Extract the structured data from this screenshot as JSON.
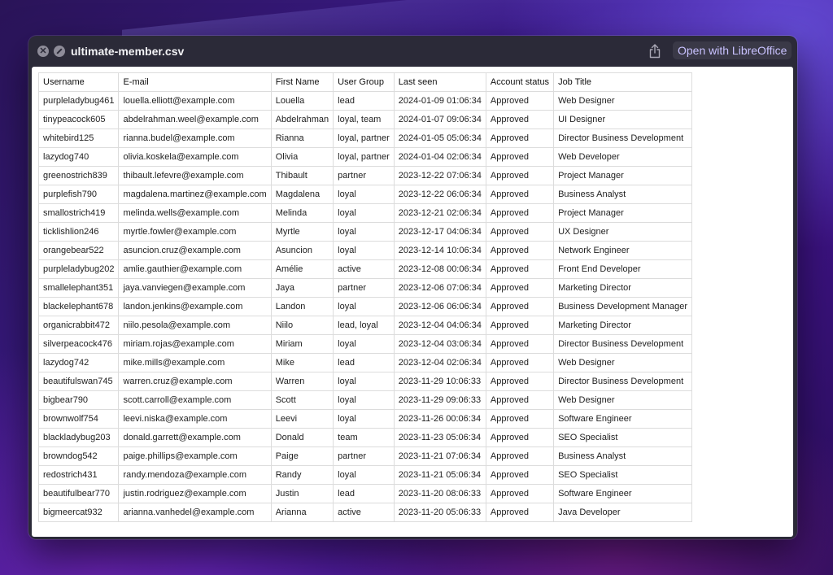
{
  "window": {
    "title": "ultimate-member.csv",
    "open_with_label": "Open with LibreOffice",
    "close_icon_glyph": "✕"
  },
  "icons": [
    "close-icon",
    "block-icon",
    "share-icon"
  ],
  "table": {
    "columns": [
      "Username",
      "E-mail",
      "First Name",
      "User Group",
      "Last seen",
      "Account status",
      "Job Title"
    ],
    "rows": [
      [
        "purpleladybug461",
        "louella.elliott@example.com",
        "Louella",
        "lead",
        "2024-01-09 01:06:34",
        "Approved",
        "Web Designer"
      ],
      [
        "tinypeacock605",
        "abdelrahman.weel@example.com",
        "Abdelrahman",
        "loyal, team",
        "2024-01-07 09:06:34",
        "Approved",
        "UI Designer"
      ],
      [
        "whitebird125",
        "rianna.budel@example.com",
        "Rianna",
        "loyal, partner",
        "2024-01-05 05:06:34",
        "Approved",
        "Director Business Development"
      ],
      [
        "lazydog740",
        "olivia.koskela@example.com",
        "Olivia",
        "loyal, partner",
        "2024-01-04 02:06:34",
        "Approved",
        "Web Developer"
      ],
      [
        "greenostrich839",
        "thibault.lefevre@example.com",
        "Thibault",
        "partner",
        "2023-12-22 07:06:34",
        "Approved",
        "Project Manager"
      ],
      [
        "purplefish790",
        "magdalena.martinez@example.com",
        "Magdalena",
        "loyal",
        "2023-12-22 06:06:34",
        "Approved",
        "Business Analyst"
      ],
      [
        "smallostrich419",
        "melinda.wells@example.com",
        "Melinda",
        "loyal",
        "2023-12-21 02:06:34",
        "Approved",
        "Project Manager"
      ],
      [
        "ticklishlion246",
        "myrtle.fowler@example.com",
        "Myrtle",
        "loyal",
        "2023-12-17 04:06:34",
        "Approved",
        "UX Designer"
      ],
      [
        "orangebear522",
        "asuncion.cruz@example.com",
        "Asuncion",
        "loyal",
        "2023-12-14 10:06:34",
        "Approved",
        "Network Engineer"
      ],
      [
        "purpleladybug202",
        "amlie.gauthier@example.com",
        "Amélie",
        "active",
        "2023-12-08 00:06:34",
        "Approved",
        "Front End Developer"
      ],
      [
        "smallelephant351",
        "jaya.vanviegen@example.com",
        "Jaya",
        "partner",
        "2023-12-06 07:06:34",
        "Approved",
        "Marketing Director"
      ],
      [
        "blackelephant678",
        "landon.jenkins@example.com",
        "Landon",
        "loyal",
        "2023-12-06 06:06:34",
        "Approved",
        "Business Development Manager"
      ],
      [
        "organicrabbit472",
        "niilo.pesola@example.com",
        "Niilo",
        "lead, loyal",
        "2023-12-04 04:06:34",
        "Approved",
        "Marketing Director"
      ],
      [
        "silverpeacock476",
        "miriam.rojas@example.com",
        "Miriam",
        "loyal",
        "2023-12-04 03:06:34",
        "Approved",
        "Director Business Development"
      ],
      [
        "lazydog742",
        "mike.mills@example.com",
        "Mike",
        "lead",
        "2023-12-04 02:06:34",
        "Approved",
        "Web Designer"
      ],
      [
        "beautifulswan745",
        "warren.cruz@example.com",
        "Warren",
        "loyal",
        "2023-11-29 10:06:33",
        "Approved",
        "Director Business Development"
      ],
      [
        "bigbear790",
        "scott.carroll@example.com",
        "Scott",
        "loyal",
        "2023-11-29 09:06:33",
        "Approved",
        "Web Designer"
      ],
      [
        "brownwolf754",
        "leevi.niska@example.com",
        "Leevi",
        "loyal",
        "2023-11-26 00:06:34",
        "Approved",
        "Software Engineer"
      ],
      [
        "blackladybug203",
        "donald.garrett@example.com",
        "Donald",
        "team",
        "2023-11-23 05:06:34",
        "Approved",
        "SEO Specialist"
      ],
      [
        "browndog542",
        "paige.phillips@example.com",
        "Paige",
        "partner",
        "2023-11-21 07:06:34",
        "Approved",
        "Business Analyst"
      ],
      [
        "redostrich431",
        "randy.mendoza@example.com",
        "Randy",
        "loyal",
        "2023-11-21 05:06:34",
        "Approved",
        "SEO Specialist"
      ],
      [
        "beautifulbear770",
        "justin.rodriguez@example.com",
        "Justin",
        "lead",
        "2023-11-20 08:06:33",
        "Approved",
        "Software Engineer"
      ],
      [
        "bigmeercat932",
        "arianna.vanhedel@example.com",
        "Arianna",
        "active",
        "2023-11-20 05:06:33",
        "Approved",
        "Java Developer"
      ]
    ]
  }
}
